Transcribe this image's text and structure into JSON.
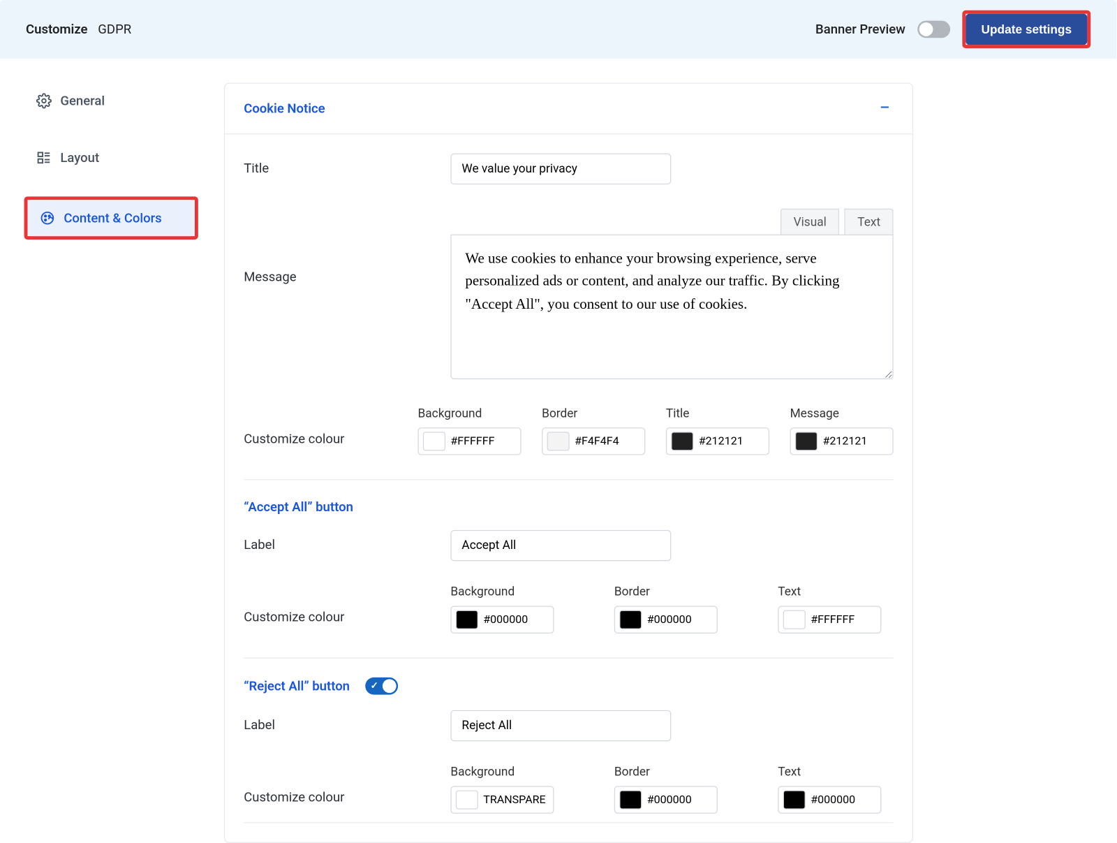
{
  "header": {
    "breadcrumb1": "Customize",
    "breadcrumb2": "GDPR",
    "preview_label": "Banner Preview",
    "update_button": "Update settings"
  },
  "sidebar": {
    "general": "General",
    "layout": "Layout",
    "content_colors": "Content & Colors"
  },
  "panel": {
    "title": "Cookie Notice"
  },
  "notice": {
    "title_label": "Title",
    "title_value": "We value your privacy",
    "message_label": "Message",
    "tab_visual": "Visual",
    "tab_text": "Text",
    "message_value": "We use cookies to enhance your browsing experience, serve personalized ads or content, and analyze our traffic. By clicking \"Accept All\", you consent to our use of cookies.",
    "customize_colour_label": "Customize colour",
    "colours": {
      "background_label": "Background",
      "background_value": "#FFFFFF",
      "border_label": "Border",
      "border_value": "#F4F4F4",
      "title_label": "Title",
      "title_value": "#212121",
      "message_label": "Message",
      "message_value": "#212121"
    }
  },
  "accept": {
    "section_title": "“Accept All” button",
    "label_label": "Label",
    "label_value": "Accept All",
    "customize_colour_label": "Customize colour",
    "colours": {
      "background_label": "Background",
      "background_value": "#000000",
      "border_label": "Border",
      "border_value": "#000000",
      "text_label": "Text",
      "text_value": "#FFFFFF"
    }
  },
  "reject": {
    "section_title": "“Reject All” button",
    "label_label": "Label",
    "label_value": "Reject All",
    "customize_colour_label": "Customize colour",
    "colours": {
      "background_label": "Background",
      "background_value": "TRANSPARE",
      "border_label": "Border",
      "border_value": "#000000",
      "text_label": "Text",
      "text_value": "#000000"
    }
  },
  "swatches": {
    "notice_background": "#FFFFFF",
    "notice_border": "#F4F4F4",
    "notice_title": "#212121",
    "notice_message": "#212121",
    "accept_background": "#000000",
    "accept_border": "#000000",
    "accept_text": "#FFFFFF",
    "reject_background": "transparent",
    "reject_border": "#000000",
    "reject_text": "#000000"
  }
}
